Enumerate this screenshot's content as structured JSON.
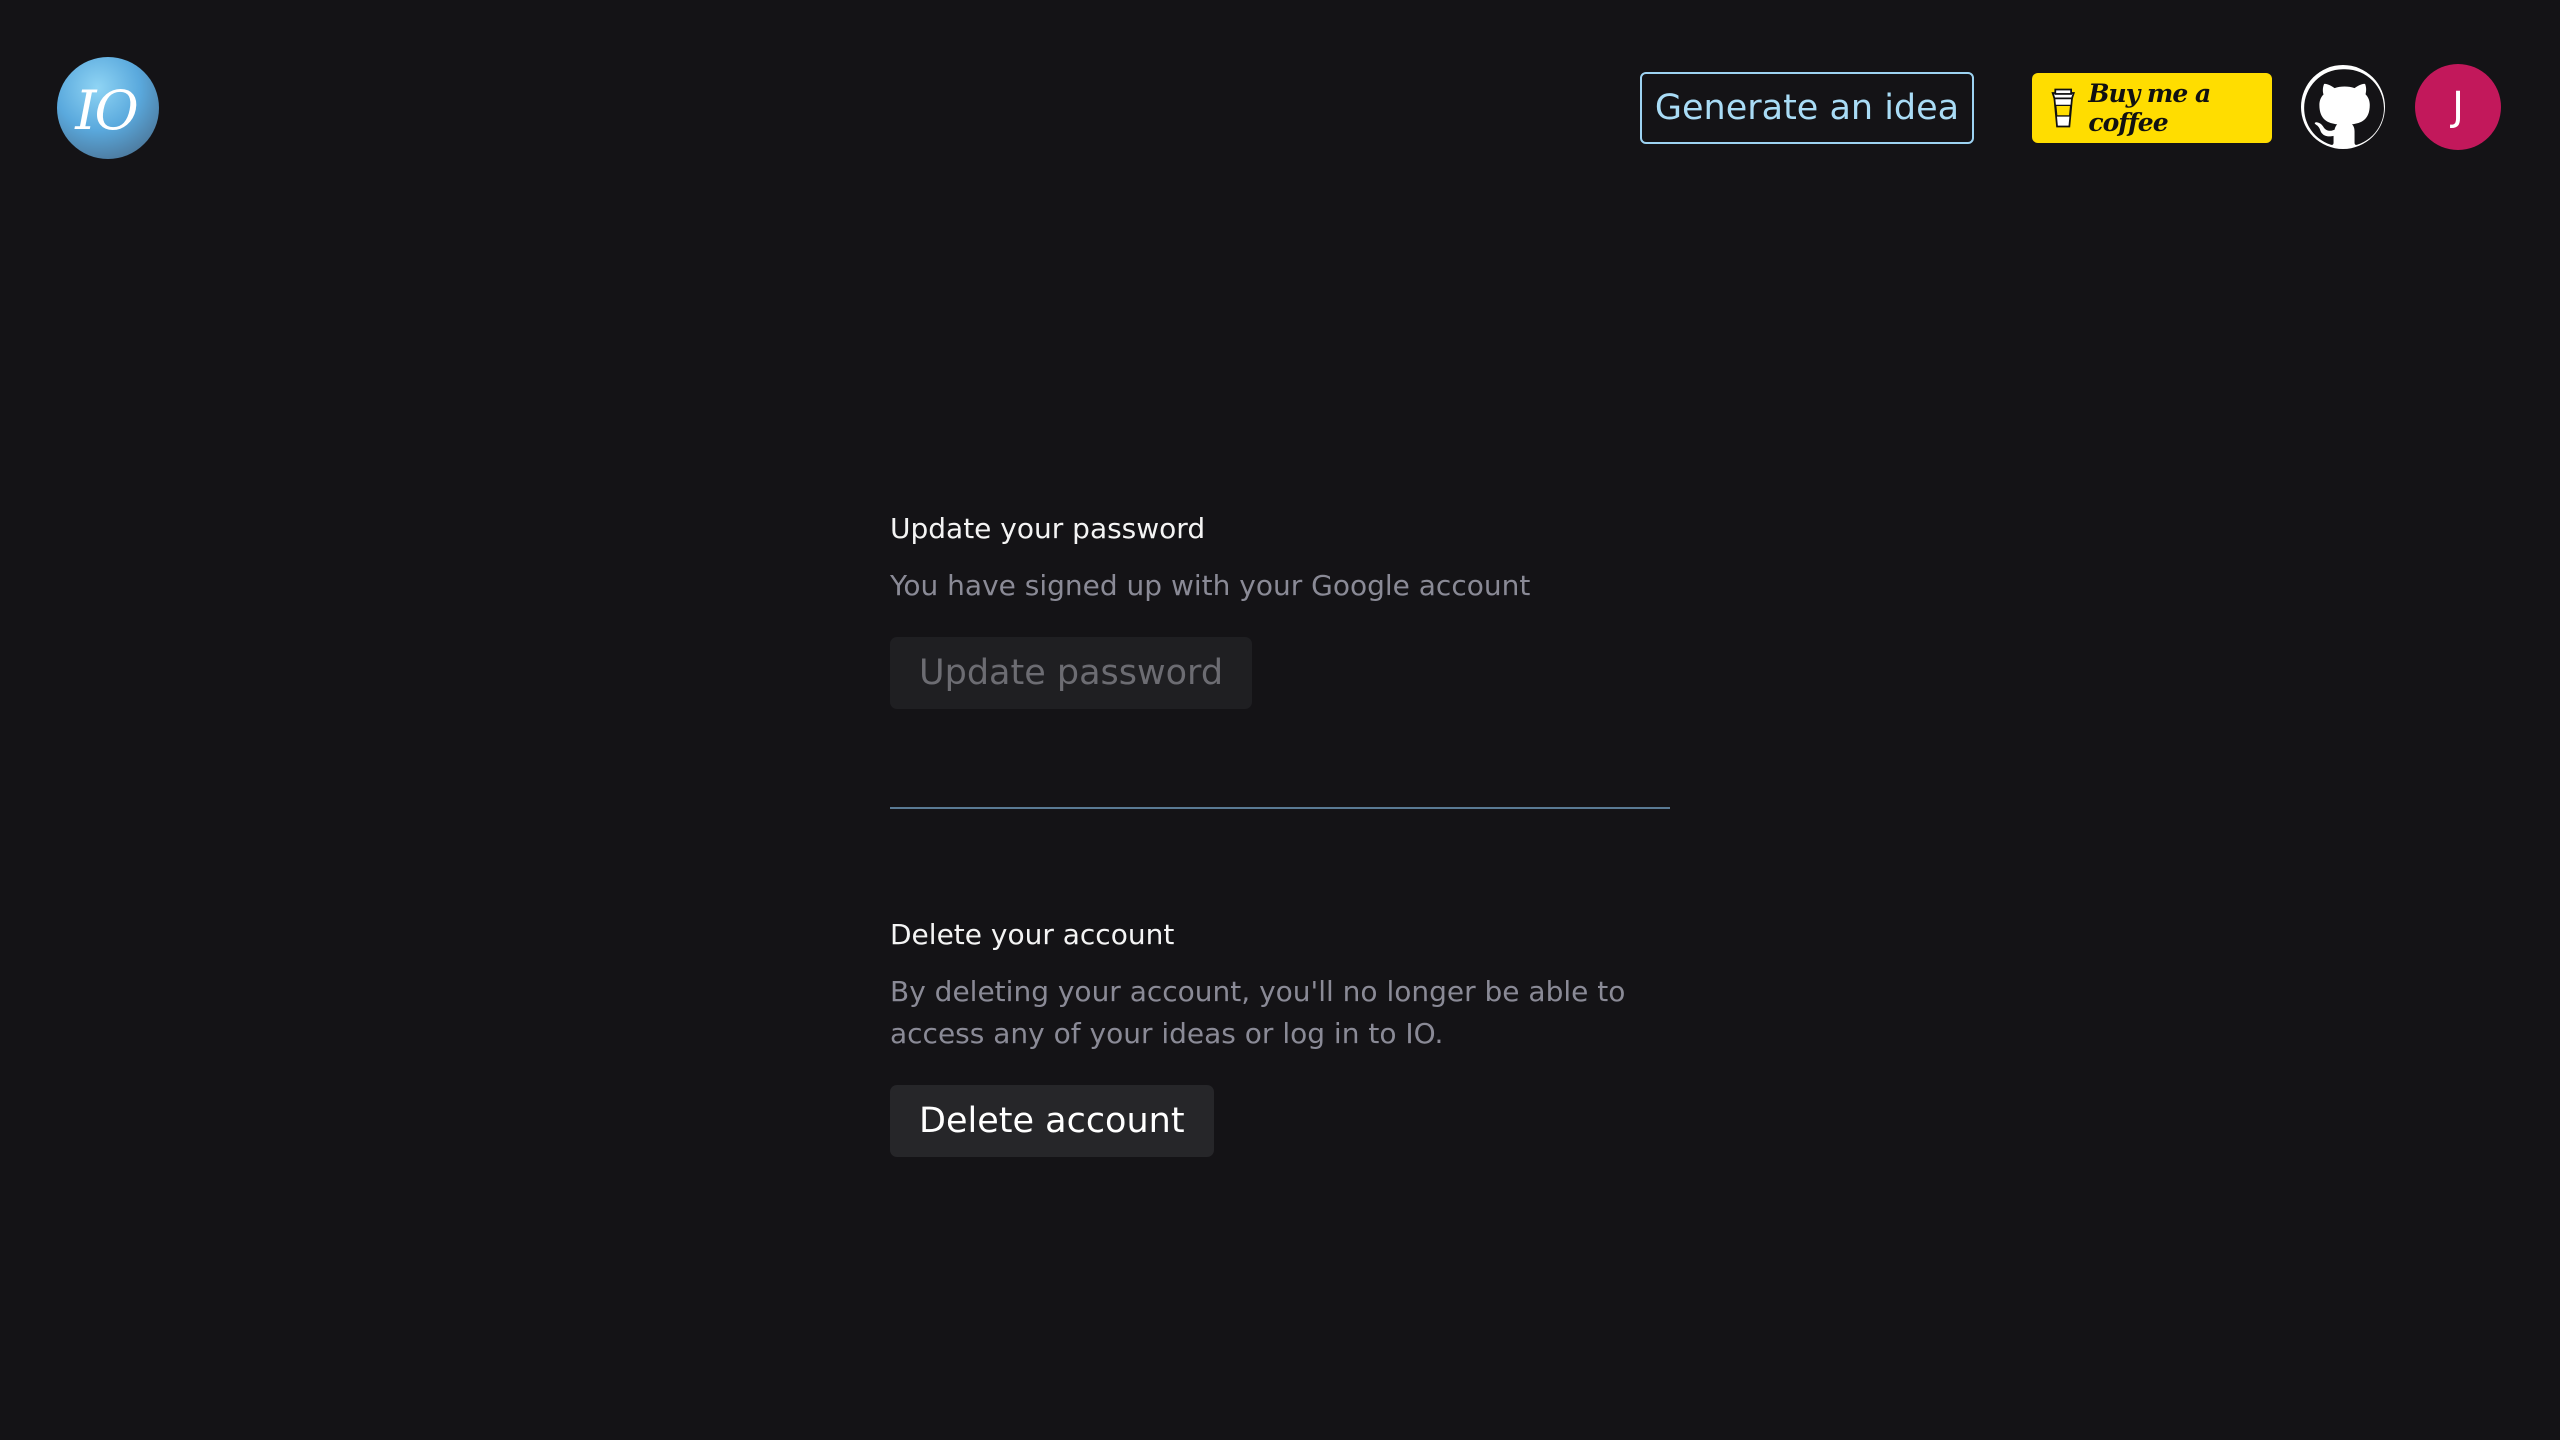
{
  "header": {
    "logo_text": "IO",
    "generate_label": "Generate an idea",
    "coffee_label": "Buy me a coffee",
    "avatar_initial": "J"
  },
  "password_section": {
    "title": "Update your password",
    "description": "You have signed up with your Google account",
    "button_label": "Update password"
  },
  "delete_section": {
    "title": "Delete your account",
    "description": "By deleting your account, you'll no longer be able to access any of your ideas or log in to IO.",
    "button_label": "Delete account"
  },
  "colors": {
    "background": "#141316",
    "accent": "#a9dcf6",
    "coffee_yellow": "#ffdd00",
    "avatar": "#c2185b"
  },
  "icons": [
    "coffee-cup-icon",
    "github-icon"
  ]
}
